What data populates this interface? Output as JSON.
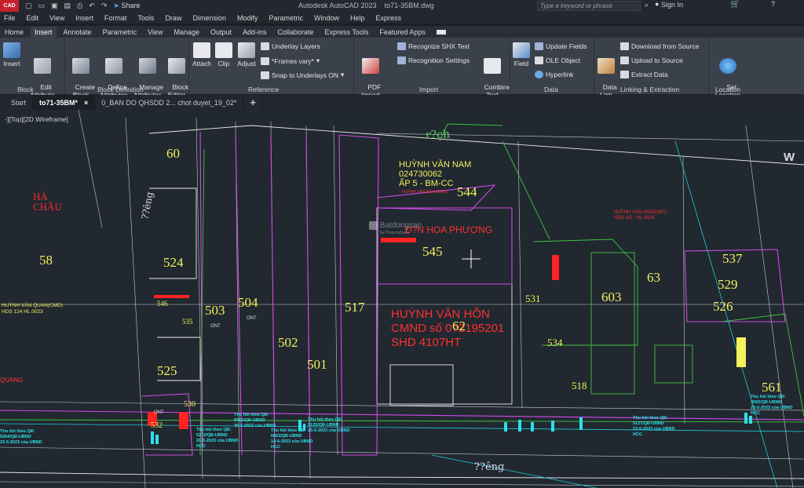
{
  "titlebar": {
    "logo": "CAD",
    "share": "Share",
    "app_title": "Autodesk AutoCAD 2023",
    "file_name": "to71-35BM.dwg",
    "search_placeholder": "Type a keyword or phrase",
    "signin": "Sign In"
  },
  "menu": [
    "File",
    "Edit",
    "View",
    "Insert",
    "Format",
    "Tools",
    "Draw",
    "Dimension",
    "Modify",
    "Parametric",
    "Window",
    "Help",
    "Express"
  ],
  "ribbon_tabs": [
    "Home",
    "Insert",
    "Annotate",
    "Parametric",
    "View",
    "Manage",
    "Output",
    "Add-ins",
    "Collaborate",
    "Express Tools",
    "Featured Apps"
  ],
  "ribbon_active_tab": "Insert",
  "ribbon": {
    "insert": "Insert",
    "edit_attribute": "Edit\nAttribute",
    "create_block": "Create\nBlock",
    "define_attributes": "Define\nAttributes",
    "manage_attributes": "Manage\nAttributes",
    "block_editor": "Block\nEditor",
    "attach": "Attach",
    "clip": "Clip",
    "adjust": "Adjust",
    "underlay_layers": "Underlay Layers",
    "frames_vary": "*Frames vary*",
    "snap_underlays": "Snap to Underlays ON",
    "pdf_import": "PDF\nImport",
    "recognize_shx": "Recognize SHX Text",
    "recognition_settings": "Recognition Settings",
    "combine_text": "Combine\nText",
    "field": "Field",
    "update_fields": "Update Fields",
    "ole_object": "OLE Object",
    "hyperlink": "Hyperlink",
    "data_link": "Data\nLink",
    "download_source": "Download from Source",
    "upload_source": "Upload to Source",
    "extract_data": "Extract  Data",
    "set_location": "Set\nLocation",
    "panels": [
      "Block",
      "Block Definition",
      "Reference",
      "Import",
      "Data",
      "Linking & Extraction",
      "Location"
    ]
  },
  "file_tabs": [
    "Start",
    "to71-35BM*",
    "0_BAN DO QHSDD 2... chot duyet_19_02*"
  ],
  "viewport_label": "-][Top][2D Wireframe]",
  "drawing": {
    "road_top": "r?ch",
    "road_bottom": "??êng",
    "road_left": "??êng",
    "place_left": [
      "HÀ",
      "CHÂU"
    ],
    "owner1": [
      "HUỲNH VĂN NAM",
      "024730062",
      "ẤP 5 - BM-CC"
    ],
    "owner1_small": "HUỲNH VĂN NAM (CMD)",
    "owner2": [
      "HUỲNH VĂN HỒN",
      "CMND số 0?2195201",
      "SHD 4107HT"
    ],
    "hoa_phuong": "Đ?N HOA PHƯỢNG",
    "watermark": "Batdongsan",
    "watermark_sub": "by PropertyGuru",
    "quan": [
      "HUỲNH VĂN QUAN(CMD)",
      "HDS 124 HL.0023"
    ],
    "lot_quang": "QUANG",
    "right_owner": [
      "HUỲNH VĂN HÁNG(MT)",
      "HDS 111 - HL.0024"
    ],
    "ont": "ONT",
    "notice_lines": [
      [
        "Thu hồi theo QĐ:",
        "5272/QĐ-UBND",
        "26-5-2023 của UBND",
        "HCC"
      ],
      [
        "Thu hồi theo QĐ:",
        "5563/QĐ-UBND",
        "30-5-2023 của UBND"
      ],
      [
        "Thu hồi theo QĐ:",
        "6053/QĐ-UBND",
        "14-6-2023 của UBND",
        "HCC"
      ],
      [
        "Thu hồi theo QĐ:",
        "5125/QĐ-UBND",
        "25-5-2023 của UBND"
      ],
      [
        "Thu hồi theo QĐ:",
        "5127/QĐ-UBND",
        "23-5-2023 của UBND",
        "HCC"
      ],
      [
        "Thu hồi theo QĐ:",
        "3060/QĐ-UBND",
        "25-5-2023 của UBND",
        "HCC"
      ],
      [
        "Thu hồi theo QĐ:",
        "5264/QĐ-UBND",
        "23-5-2023 của UBND"
      ]
    ],
    "lots": [
      "60",
      "58",
      "524",
      "546",
      "535",
      "525",
      "532",
      "530",
      "503",
      "504",
      "502",
      "501",
      "517",
      "544",
      "545",
      "62",
      "531",
      "534",
      "518",
      "603",
      "63",
      "537",
      "529",
      "526",
      "561"
    ],
    "compass": "W"
  },
  "colors": {
    "bg": "#212830",
    "lot_number": "#f2f25a",
    "owner_red": "#ff2a2a",
    "magenta": "#e040ff",
    "green": "#4bd44b",
    "cyan": "#2ce0e8",
    "white_line": "#d9dde2"
  }
}
